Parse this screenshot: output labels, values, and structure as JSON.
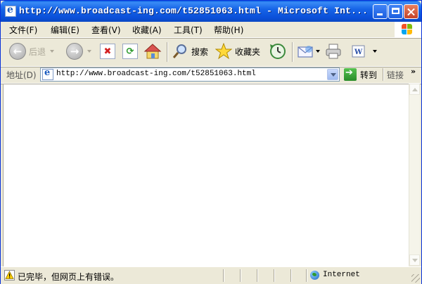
{
  "window": {
    "title": "http://www.broadcast-ing.com/t52851063.html - Microsoft Int..."
  },
  "menu": {
    "items": [
      "文件(F)",
      "编辑(E)",
      "查看(V)",
      "收藏(A)",
      "工具(T)",
      "帮助(H)"
    ]
  },
  "toolbar": {
    "back_label": "后退",
    "search_label": "搜索",
    "favorites_label": "收藏夹"
  },
  "address": {
    "label": "地址(D)",
    "url": "http://www.broadcast-ing.com/t52851063.html",
    "go_label": "转到",
    "links_label": "链接",
    "more_glyph": "»"
  },
  "status": {
    "text": "已完毕，但网页上有错误。",
    "zone": "Internet"
  },
  "colors": {
    "titlebar": "#0a5fe3",
    "chrome": "#ece9d8",
    "close_button": "#c4432a"
  }
}
